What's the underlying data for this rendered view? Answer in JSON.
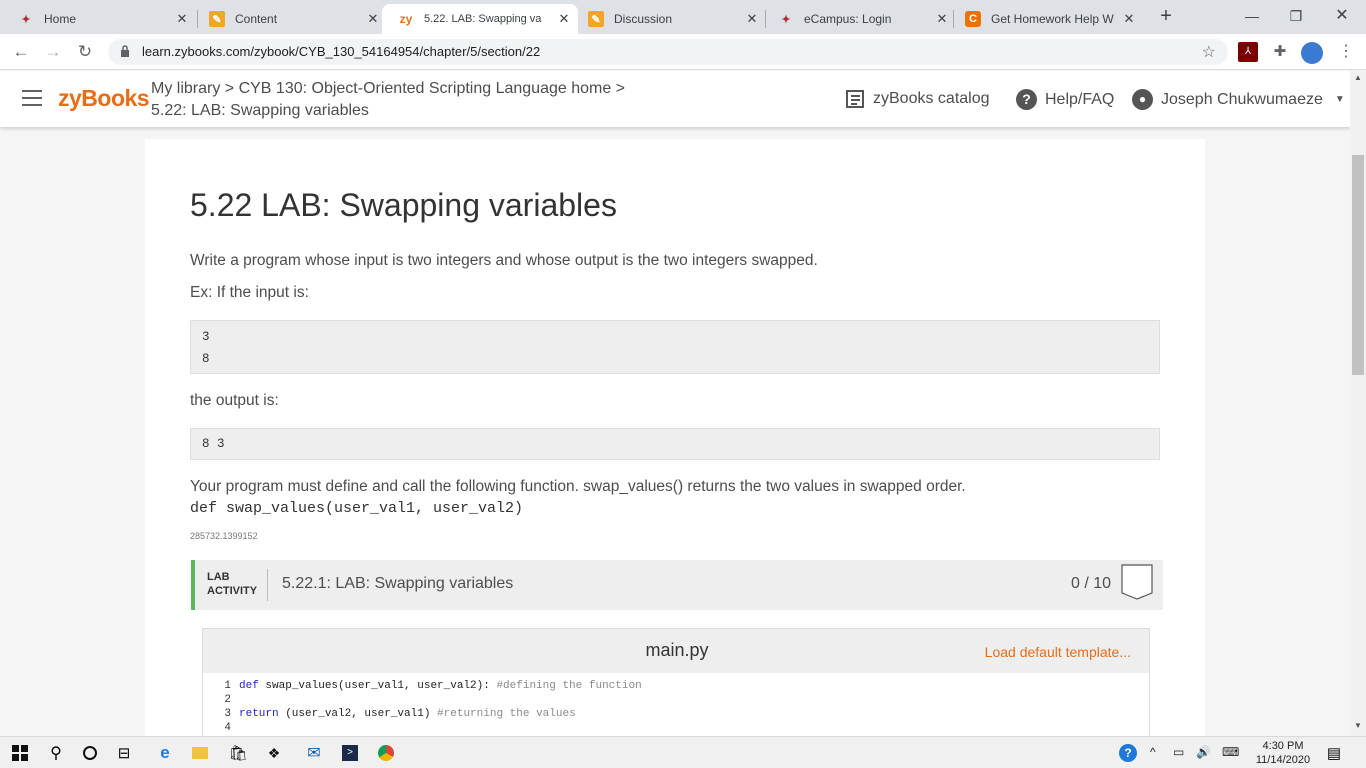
{
  "browser": {
    "tabs": [
      {
        "title": "Home",
        "icon": "ecampus-eagle-icon",
        "active": false
      },
      {
        "title": "Content",
        "icon": "pencil-icon",
        "active": false
      },
      {
        "title": "5.22. LAB: Swapping va",
        "icon": "zy-icon",
        "active": true
      },
      {
        "title": "Discussion",
        "icon": "pencil-icon",
        "active": false
      },
      {
        "title": "eCampus: Login",
        "icon": "ecampus-eagle-icon",
        "active": false
      },
      {
        "title": "Get Homework Help W",
        "icon": "chegg-c-icon",
        "active": false
      }
    ],
    "url": "learn.zybooks.com/zybook/CYB_130_54164954/chapter/5/section/22"
  },
  "header": {
    "logo": "zyBooks",
    "breadcrumb_line1": "My library > CYB 130: Object-Oriented Scripting Language home >",
    "breadcrumb_line2": "5.22: LAB: Swapping variables",
    "catalog": "zyBooks catalog",
    "help": "Help/FAQ",
    "user": "Joseph Chukwumaeze"
  },
  "section": {
    "title": "5.22 LAB: Swapping variables",
    "intro": "Write a program whose input is two integers and whose output is the two integers swapped.",
    "ex_label": "Ex: If the input is:",
    "input_lines": [
      "3",
      "8"
    ],
    "output_label": "the output is:",
    "output_line": "8 3",
    "requirement": "Your program must define and call the following function. swap_values() returns the two values in swapped order.",
    "signature": "def swap_values(user_val1, user_val2)",
    "id_text": "285732.1399152"
  },
  "lab": {
    "tag_line1": "LAB",
    "tag_line2": "ACTIVITY",
    "title": "5.22.1: LAB: Swapping variables",
    "score": "0 / 10",
    "filename": "main.py",
    "load_template": "Load default template...",
    "code": [
      {
        "num": "1",
        "kw": "def",
        "text": " swap_values(user_val1, user_val2): ",
        "comment": "#defining the function"
      },
      {
        "num": "2",
        "kw": "",
        "text": "",
        "comment": ""
      },
      {
        "num": "3",
        "kw": "return",
        "text": " (user_val2, user_val1) ",
        "comment": "#returning the values"
      },
      {
        "num": "4",
        "kw": "",
        "text": "",
        "comment": ""
      }
    ]
  },
  "taskbar": {
    "time": "4:30 PM",
    "date": "11/14/2020"
  },
  "colors": {
    "brand_orange": "#e96d17",
    "lab_green": "#5cb85c"
  }
}
